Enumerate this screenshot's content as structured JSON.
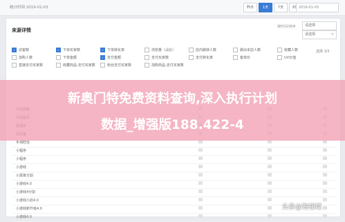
{
  "topbar": {
    "stat_label": "统计时间",
    "date": "2019-01-03",
    "ranges": [
      "昨日",
      "1天",
      "7天",
      "30天",
      "月",
      "自定义"
    ],
    "date_picker": "2019-01-03"
  },
  "card": {
    "title": "来源详情",
    "sort_label": "按时间/排序",
    "sort_select": "请选择",
    "sort_select2": "请选择"
  },
  "checkboxes": [
    {
      "label": "访客数",
      "checked": true
    },
    {
      "label": "下单买家数",
      "checked": true
    },
    {
      "label": "下单转化率",
      "checked": true
    },
    {
      "label": "浏览量（占比）",
      "checked": false
    },
    {
      "label": "店内跳转人数",
      "checked": false
    },
    {
      "label": "跳出本店人数",
      "checked": false
    },
    {
      "label": "收藏人数",
      "checked": false
    },
    {
      "label": "加购人数",
      "checked": false
    },
    {
      "label": "下单金额",
      "checked": false
    },
    {
      "label": "支付金额",
      "checked": true
    },
    {
      "label": "支付买家数",
      "checked": false
    },
    {
      "label": "支付转化率",
      "checked": false
    },
    {
      "label": "客单价",
      "checked": false
    },
    {
      "label": "UV价值",
      "checked": false
    },
    {
      "label": "直接支付买家数",
      "checked": false
    },
    {
      "label": "收藏商品-支付买家数",
      "checked": false
    },
    {
      "label": "粉丝支付买家数",
      "checked": false
    },
    {
      "label": "加购商品-支付买家数",
      "checked": false
    }
  ],
  "page_info": "选择 3/5",
  "banner": {
    "line1": "新奥门特免费资料查询,深入执行计划",
    "line2": "数据_增强版188.422-4"
  },
  "rows": [
    "手淘搜索",
    "手淘首页",
    "直通车",
    "淘宝客",
    "手淘旺信",
    "小程序",
    "小程序",
    "小游戏",
    "小黑板分割",
    "小游戏4.0",
    "小游戏4分割",
    "小游戏小店4.0",
    "小游戏新升级4.0",
    "小游戏4.0"
  ],
  "watermark": "头条@淘领域"
}
